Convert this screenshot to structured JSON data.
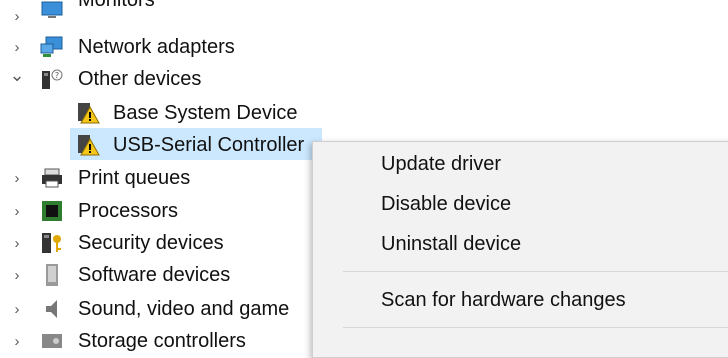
{
  "tree": {
    "items": [
      {
        "label": "Monitors",
        "chevron": "›",
        "icon": "monitor-icon"
      },
      {
        "label": "Network adapters",
        "chevron": "›",
        "icon": "network-adapter-icon"
      },
      {
        "label": "Other devices",
        "chevron": "⌄",
        "icon": "other-devices-icon"
      },
      {
        "label": "Base System Device",
        "chevron": "",
        "icon": "warning-device-icon"
      },
      {
        "label": "USB-Serial Controller",
        "chevron": "",
        "icon": "warning-device-icon"
      },
      {
        "label": "Print queues",
        "chevron": "›",
        "icon": "printer-icon"
      },
      {
        "label": "Processors",
        "chevron": "›",
        "icon": "processor-icon"
      },
      {
        "label": "Security devices",
        "chevron": "›",
        "icon": "security-device-icon"
      },
      {
        "label": "Software devices",
        "chevron": "›",
        "icon": "software-device-icon"
      },
      {
        "label": "Sound, video and game",
        "chevron": "›",
        "icon": "speaker-icon"
      },
      {
        "label": "Storage controllers",
        "chevron": "›",
        "icon": "storage-controller-icon"
      }
    ]
  },
  "context_menu": {
    "items": [
      {
        "label": "Update driver"
      },
      {
        "label": "Disable device"
      },
      {
        "label": "Uninstall device"
      },
      {
        "label": "Scan for hardware changes"
      }
    ]
  },
  "colors": {
    "selection": "#cce8ff",
    "menu_background": "#f2f2f2",
    "warning": "#f5c518"
  }
}
